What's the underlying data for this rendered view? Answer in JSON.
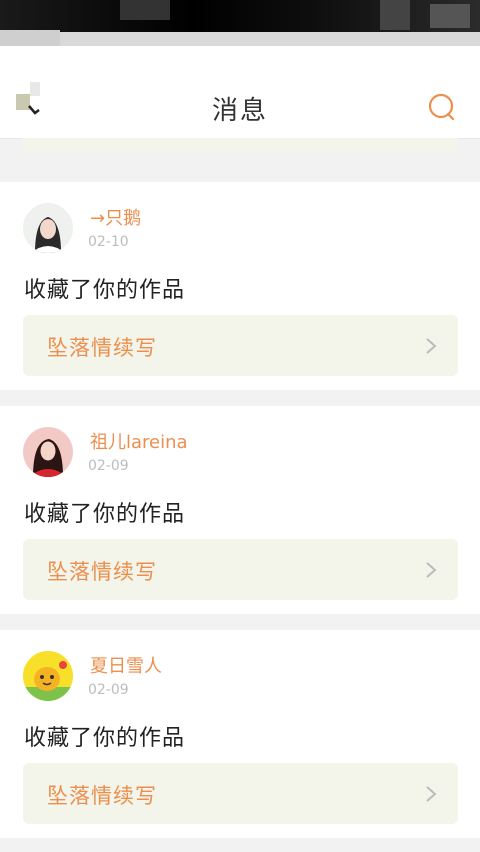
{
  "header": {
    "title": "消息"
  },
  "icons": {
    "back": "back-icon",
    "search": "search-icon",
    "chevron": "chevron-right-icon"
  },
  "colors": {
    "accent": "#ec8f4e",
    "work_bg": "#f3f4ea",
    "date": "#bdbdbd"
  },
  "messages": [
    {
      "username": "→只鹅",
      "date": "02-10",
      "action": "收藏了你的作品",
      "work_title": "坠落情续写"
    },
    {
      "username": "祖儿lareina",
      "date": "02-09",
      "action": "收藏了你的作品",
      "work_title": "坠落情续写"
    },
    {
      "username": "夏日雪人",
      "date": "02-09",
      "action": "收藏了你的作品",
      "work_title": "坠落情续写"
    }
  ]
}
